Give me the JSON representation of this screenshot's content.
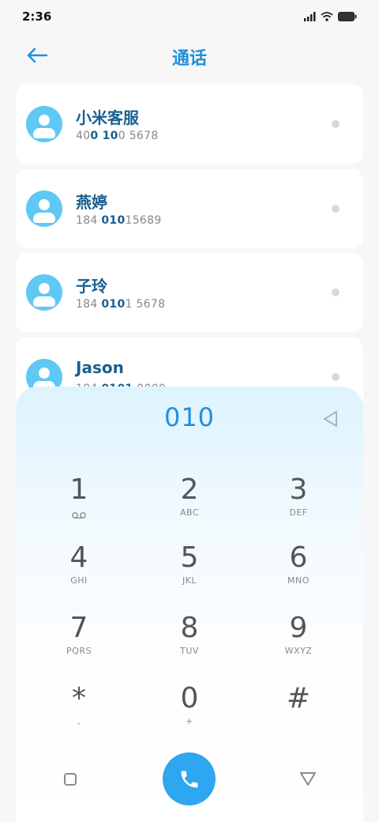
{
  "status": {
    "time": "2:36",
    "icons": [
      "signal-icon",
      "wifi-icon",
      "battery-icon"
    ]
  },
  "header": {
    "title": "通话",
    "back_icon": "back-arrow-icon"
  },
  "contacts": [
    {
      "name": "小米客服",
      "number_parts": [
        "40",
        "0 10",
        "0 5678"
      ],
      "highlight": [
        false,
        true,
        false
      ]
    },
    {
      "name": "燕婷",
      "number_parts": [
        "184 ",
        "010",
        "15689"
      ],
      "highlight": [
        false,
        true,
        false
      ]
    },
    {
      "name": "子玲",
      "number_parts": [
        "184 ",
        "010",
        "1 5678"
      ],
      "highlight": [
        false,
        true,
        false
      ]
    },
    {
      "name": "Jason",
      "number_parts": [
        "184 ",
        "0101",
        " 0000"
      ],
      "highlight": [
        false,
        true,
        false
      ]
    }
  ],
  "dialpad": {
    "display": "010",
    "keys": [
      {
        "digit": "1",
        "letters": ""
      },
      {
        "digit": "2",
        "letters": "ABC"
      },
      {
        "digit": "3",
        "letters": "DEF"
      },
      {
        "digit": "4",
        "letters": "GHI"
      },
      {
        "digit": "5",
        "letters": "JKL"
      },
      {
        "digit": "6",
        "letters": "MNO"
      },
      {
        "digit": "7",
        "letters": "PQRS"
      },
      {
        "digit": "8",
        "letters": "TUV"
      },
      {
        "digit": "9",
        "letters": "WXYZ"
      },
      {
        "digit": "*",
        "letters": ","
      },
      {
        "digit": "0",
        "letters": "+"
      },
      {
        "digit": "#",
        "letters": ""
      }
    ]
  },
  "colors": {
    "accent": "#1e90e0",
    "call": "#2ea6f0",
    "avatar": "#5fc8f5",
    "name": "#1a5f8f"
  }
}
